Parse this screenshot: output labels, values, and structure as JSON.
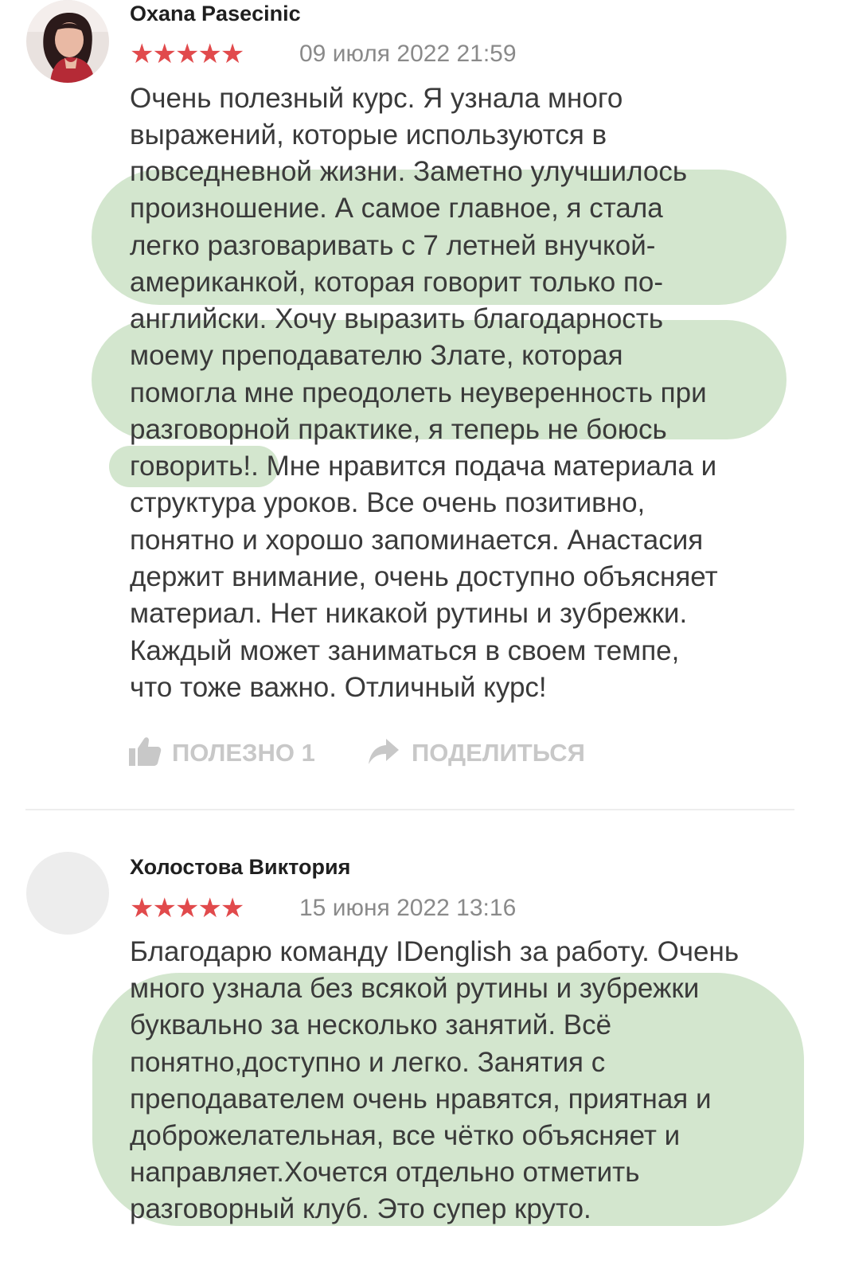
{
  "reviews": [
    {
      "author": "Oxana Pasecinic",
      "rating": 5,
      "stars": "★★★★★",
      "date": "09 июля 2022 21:59",
      "text_lines": [
        "Очень полезный курс. Я узнала много",
        "выражений, которые используются в",
        "повседневной жизни. Заметно улучшилось",
        "произношение. А самое главное, я стала",
        "легко разговаривать с 7 летней внучкой-",
        "американкой, которая говорит только по-",
        "английски. Хочу выразить благодарность",
        "моему преподавателю Злате, которая",
        "помогла мне преодолеть неуверенность при",
        "разговорной практике, я теперь не боюсь",
        "говорить!. Мне нравится подача материала и",
        "структура уроков. Все очень позитивно,",
        "понятно и хорошо запоминается. Анастасия",
        "держит внимание, очень доступно объясняет",
        "материал. Нет никакой рутины и зубрежки.",
        "Каждый может заниматься в своем темпе,",
        "что тоже важно. Отличный курс!"
      ],
      "helpful_label": "ПОЛЕЗНО 1",
      "share_label": "ПОДЕЛИТЬСЯ"
    },
    {
      "author": "Холостова Виктория",
      "rating": 5,
      "stars": "★★★★★",
      "date": "15 июня 2022 13:16",
      "text_lines": [
        "Благодарю команду IDenglish за работу. Очень",
        "много узнала без всякой рутины и зубрежки",
        "буквально за несколько занятий. Всё",
        "понятно,доступно и легко. Занятия с",
        "преподавателем очень нравятся, приятная и",
        "доброжелательная, все чётко объясняет и",
        "направляет.Хочется отдельно отметить",
        "разговорный клуб. Это супер круто."
      ]
    }
  ],
  "colors": {
    "star": "#e14a4c",
    "highlight": "#d3e6ce",
    "muted": "#c8c8c8"
  }
}
